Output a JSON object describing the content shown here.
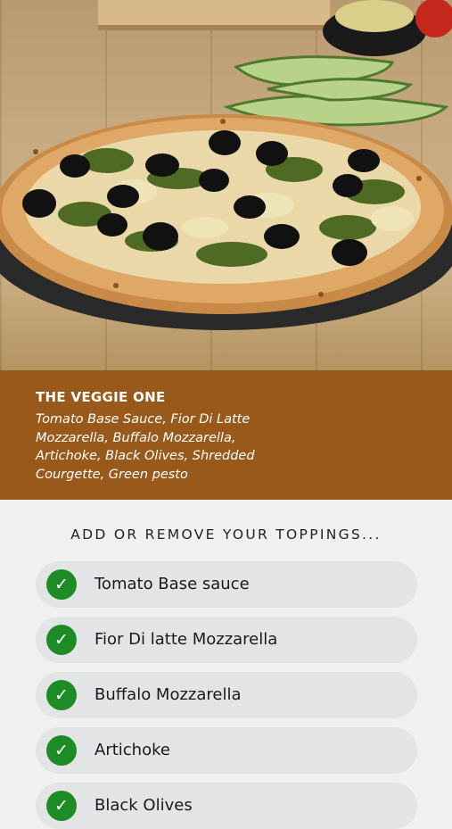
{
  "product": {
    "name": "THE VEGGIE ONE",
    "description": "Tomato Base Sauce, Fior Di Latte Mozzarella, Buffalo Mozzarella, Artichoke, Black Olives, Shredded Courgette, Green pesto"
  },
  "toppings": {
    "heading": "ADD OR REMOVE YOUR TOPPINGS...",
    "items": [
      {
        "label": "Tomato Base sauce",
        "selected": true
      },
      {
        "label": "Fior Di latte Mozzarella",
        "selected": true
      },
      {
        "label": "Buffalo Mozzarella",
        "selected": true
      },
      {
        "label": "Artichoke",
        "selected": true
      },
      {
        "label": "Black Olives",
        "selected": true
      }
    ],
    "check_glyph": "✓"
  },
  "colors": {
    "info_bg": "#98591a",
    "check_green": "#1e8c26",
    "pill_bg": "#e3e4e6"
  },
  "icons": {
    "check": "checkmark-icon"
  }
}
